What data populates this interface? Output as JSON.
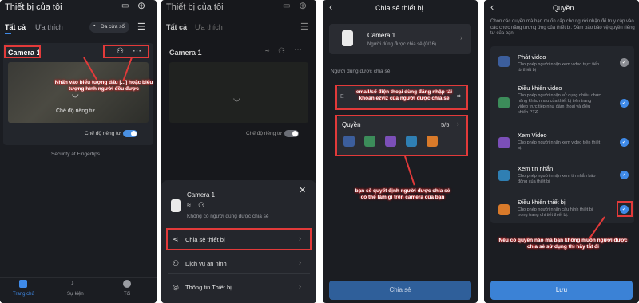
{
  "p1": {
    "title": "Thiết bị của tôi",
    "tabs": [
      "Tất cả",
      "Ưa thích"
    ],
    "multi_window": "Đa cửa sổ",
    "camera_name": "Camera 1",
    "privacy_center": "Chế độ riêng tư",
    "privacy_row": "Chế độ riêng tư",
    "security": "Security at Fingertips",
    "nav": [
      "Trang chủ",
      "Sự kiện",
      "Tôi"
    ],
    "annotation": "Nhấn vào biểu tượng dấu [...] hoặc biểu tượng hình người đều được"
  },
  "p2": {
    "title": "Thiết bị của tôi",
    "tabs": [
      "Tất cả",
      "Ưa thích"
    ],
    "camera_name": "Camera 1",
    "privacy_row": "Chế độ riêng tư",
    "sheet_camera": "Camera 1",
    "sheet_status": "Không có người dùng được chia sẻ",
    "menu": [
      "Chia sẻ thiết bị",
      "Dịch vụ an ninh",
      "Thông tin Thiết bị"
    ]
  },
  "p3": {
    "title": "Chia sẻ thiết bị",
    "camera_name": "Camera 1",
    "shared_count": "Người dùng được chia sẻ (0/16)",
    "section": "Người dùng được chia sẻ",
    "input_prefix": "E",
    "annotation_input": "email/số điện thoại dùng đăng nhập tài khoản ezviz của người được chia sẻ",
    "perm_label": "Quyền",
    "perm_count": "5/5",
    "annotation_perm": "bạn sẽ quyết định người được chia sẻ có thể làm gì trên camera của bạn",
    "share_button": "Chia sẻ"
  },
  "p4": {
    "title": "Quyền",
    "intro": "Chọn các quyền mà bạn muốn cấp cho người nhận để truy cập vào các chức năng tương ứng của thiết bị. Đảm bảo bảo vệ quyền riêng tư của bạn.",
    "items": [
      {
        "title": "Phát video",
        "desc": [
          "Cho phép người nhận xem video trực tiếp",
          "từ thiết bị"
        ]
      },
      {
        "title": "Điều khiển video",
        "desc": [
          "Cho phép người nhận sử dụng nhiều chức",
          "năng khác nhau của thiết bị trên trang",
          "video trực tiếp như đàm thoại và điều",
          "khiển PTZ"
        ]
      },
      {
        "title": "Xem Video",
        "desc": [
          "Cho phép người nhận xem video trên thiết",
          "bị."
        ]
      },
      {
        "title": "Xem tin nhắn",
        "desc": [
          "Cho phép người nhận xem tin nhắn báo",
          "động của thiết bị"
        ]
      },
      {
        "title": "Điều khiển thiết bị",
        "desc": [
          "Cho phép người nhận cấu hình thiết bị",
          "trong trang chi tiết thiết bị."
        ]
      }
    ],
    "annotation": "Nếu có quyền nào mà bạn không muốn người được chia sẻ sử dụng thì hãy tắt đi",
    "save_button": "Lưu"
  }
}
